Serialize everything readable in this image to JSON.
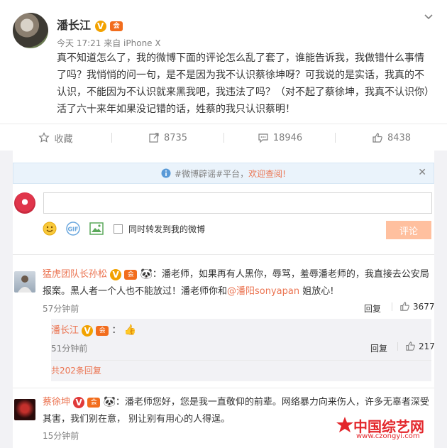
{
  "post": {
    "author": "潘长江",
    "verified_mark": "V",
    "vip_mark": "会",
    "time": "今天 17:21",
    "source": "来自 iPhone X",
    "content": "真不知道怎么了，我的微博下面的评论怎么乱了套了，谁能告诉我，我做错什么事情了吗？我悄悄的问一句，是不是因为我不认识蔡徐坤呀？可我说的是实话，我真的不认识，不能因为不认识就来黑我吧，我违法了吗？（对不起了蔡徐坤，我真不认识你）活了六十来年如果没记错的话，姓蔡的我只认识蔡明！",
    "actions": {
      "favorite_label": "收藏",
      "repost_count": "8735",
      "comment_count": "18946",
      "like_count": "8438"
    }
  },
  "notice": {
    "text": "#微博辟谣#平台，",
    "link": "欢迎查阅!"
  },
  "composer": {
    "placeholder": "",
    "sync_label": "同时转发到我的微博",
    "submit_label": "评论"
  },
  "comments": [
    {
      "user": "猛虎团队长孙松",
      "text_before": "：潘老师，如果再有人黑你，辱骂，羞辱潘老师的，我直接去公安局报案。黑人者一个人也不能放过！潘老师你和",
      "mention": "@潘阳sonyapan",
      "text_after": " 姐放心!",
      "time": "57分钟前",
      "reply_label": "回复",
      "likes": "3677",
      "replies": [
        {
          "user": "潘长江",
          "text": "：",
          "time": "51分钟前",
          "reply_label": "回复",
          "likes": "217"
        }
      ],
      "more_replies": "共202条回复"
    },
    {
      "user": "蔡徐坤",
      "text": "：潘老师您好，您是我一直敬仰的前辈。网络暴力向来伤人，许多无辜者深受其害，我们别在意， 别让别有用心的人得逞。",
      "time": "15分钟前"
    }
  ],
  "watermark": {
    "text": "中国综艺网",
    "url": "www.czongyi.com"
  },
  "colors": {
    "accent": "#eb7350",
    "gold": "#f2a200",
    "notice_bg": "#eaf3fb",
    "submit_bg": "#ffc09f"
  }
}
